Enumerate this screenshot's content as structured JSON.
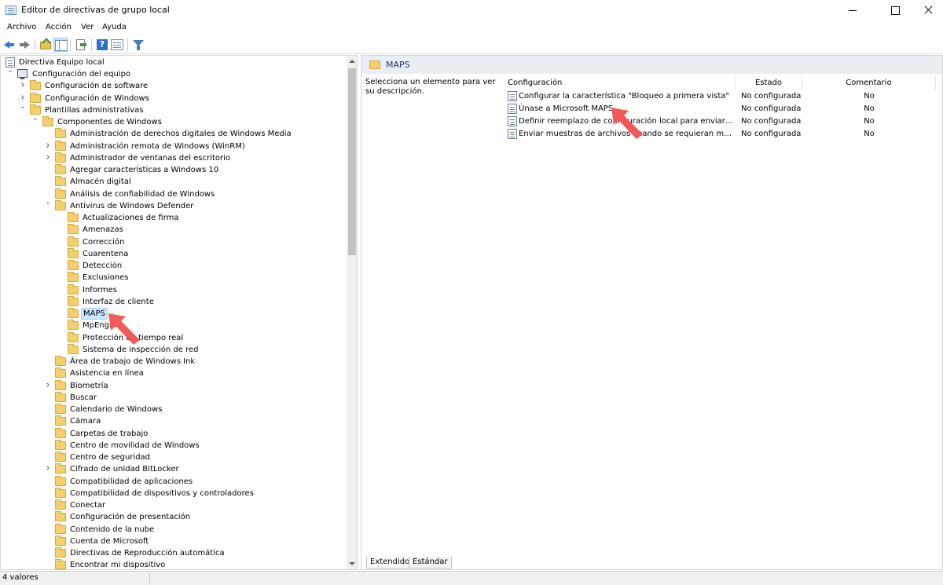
{
  "window": {
    "title": "Editor de directivas de grupo local"
  },
  "menu": [
    "Archivo",
    "Acción",
    "Ver",
    "Ayuda"
  ],
  "tree": {
    "root": "Directiva Equipo local",
    "items": [
      {
        "label": "Configuración del equipo",
        "level": 1,
        "expander": "open",
        "icon": "computer-icon"
      },
      {
        "label": "Configuración de software",
        "level": 2,
        "expander": "closed"
      },
      {
        "label": "Configuración de Windows",
        "level": 2,
        "expander": "closed"
      },
      {
        "label": "Plantillas administrativas",
        "level": 2,
        "expander": "open"
      },
      {
        "label": "Componentes de Windows",
        "level": 3,
        "expander": "open"
      },
      {
        "label": "Administración de derechos digitales de Windows Media",
        "level": 4,
        "expander": "none"
      },
      {
        "label": "Administración remota de Windows (WinRM)",
        "level": 4,
        "expander": "closed"
      },
      {
        "label": "Administrador de ventanas del escritorio",
        "level": 4,
        "expander": "closed"
      },
      {
        "label": "Agregar características a Windows 10",
        "level": 4,
        "expander": "none"
      },
      {
        "label": "Almacén digital",
        "level": 4,
        "expander": "none"
      },
      {
        "label": "Análisis de confiabilidad de Windows",
        "level": 4,
        "expander": "none"
      },
      {
        "label": "Antivirus de Windows Defender",
        "level": 4,
        "expander": "open"
      },
      {
        "label": "Actualizaciones de firma",
        "level": 5,
        "expander": "none"
      },
      {
        "label": "Amenazas",
        "level": 5,
        "expander": "none"
      },
      {
        "label": "Corrección",
        "level": 5,
        "expander": "none"
      },
      {
        "label": "Cuarentena",
        "level": 5,
        "expander": "none"
      },
      {
        "label": "Detección",
        "level": 5,
        "expander": "none"
      },
      {
        "label": "Exclusiones",
        "level": 5,
        "expander": "none"
      },
      {
        "label": "Informes",
        "level": 5,
        "expander": "none"
      },
      {
        "label": "Interfaz de cliente",
        "level": 5,
        "expander": "none"
      },
      {
        "label": "MAPS",
        "level": 5,
        "expander": "none",
        "selected": true
      },
      {
        "label": "MpEngine",
        "level": 5,
        "expander": "none"
      },
      {
        "label": "Protección en tiempo real",
        "level": 5,
        "expander": "none"
      },
      {
        "label": "Sistema de inspección de red",
        "level": 5,
        "expander": "none"
      },
      {
        "label": "Área de trabajo de Windows Ink",
        "level": 4,
        "expander": "none"
      },
      {
        "label": "Asistencia en línea",
        "level": 4,
        "expander": "none"
      },
      {
        "label": "Biometría",
        "level": 4,
        "expander": "closed"
      },
      {
        "label": "Buscar",
        "level": 4,
        "expander": "none"
      },
      {
        "label": "Calendario de Windows",
        "level": 4,
        "expander": "none"
      },
      {
        "label": "Cámara",
        "level": 4,
        "expander": "none"
      },
      {
        "label": "Carpetas de trabajo",
        "level": 4,
        "expander": "none"
      },
      {
        "label": "Centro de movilidad de Windows",
        "level": 4,
        "expander": "none"
      },
      {
        "label": "Centro de seguridad",
        "level": 4,
        "expander": "none"
      },
      {
        "label": "Cifrado de unidad BitLocker",
        "level": 4,
        "expander": "closed"
      },
      {
        "label": "Compatibilidad de aplicaciones",
        "level": 4,
        "expander": "none"
      },
      {
        "label": "Compatibilidad de dispositivos y controladores",
        "level": 4,
        "expander": "none"
      },
      {
        "label": "Conectar",
        "level": 4,
        "expander": "none"
      },
      {
        "label": "Configuración de presentación",
        "level": 4,
        "expander": "none"
      },
      {
        "label": "Contenido de la nube",
        "level": 4,
        "expander": "none"
      },
      {
        "label": "Cuenta de Microsoft",
        "level": 4,
        "expander": "none"
      },
      {
        "label": "Directivas de Reproducción automática",
        "level": 4,
        "expander": "none"
      },
      {
        "label": "Encontrar mi dispositivo",
        "level": 4,
        "expander": "none"
      }
    ]
  },
  "details": {
    "header": "MAPS",
    "description": "Selecciona un elemento para ver su descripción.",
    "columns": [
      "Configuración",
      "Estado",
      "Comentario"
    ],
    "rows": [
      {
        "name": "Configurar la característica \"Bloqueo a primera vista\"",
        "estado": "No configurada",
        "comentario": "No"
      },
      {
        "name": "Únase a Microsoft MAPS",
        "estado": "No configurada",
        "comentario": "No"
      },
      {
        "name": "Definir reemplazo de configuración local para enviar informes a Microsoft MAPS",
        "estado": "No configurada",
        "comentario": "No"
      },
      {
        "name": "Enviar muestras de archivos cuando se requieran más análisis",
        "estado": "No configurada",
        "comentario": "No"
      }
    ],
    "tabs": [
      "Extendido",
      "Estándar"
    ]
  },
  "status": {
    "text": "4 valores"
  },
  "colors": {
    "annotation_arrow": "#f25a5a",
    "selection": "#cce8ff",
    "folder": "#f3cf6e"
  }
}
